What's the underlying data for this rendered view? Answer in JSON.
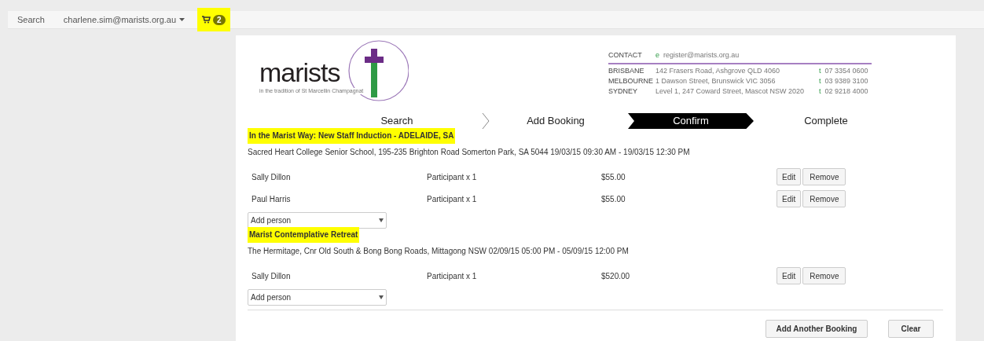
{
  "topbar": {
    "search": "Search",
    "user": "charlene.sim@marists.org.au",
    "cart": {
      "count": "2",
      "highlighted": true
    }
  },
  "logo": {
    "wordmark": "marists",
    "tagline": "in the tradition of St Marcellin Champagnat"
  },
  "contact": {
    "label": "CONTACT",
    "email_prefix": "e",
    "email": "register@marists.org.au",
    "offices": [
      {
        "city": "BRISBANE",
        "address": "142 Frasers Road, Ashgrove QLD 4060",
        "phone_prefix": "t",
        "phone": "07 3354 0600"
      },
      {
        "city": "MELBOURNE",
        "address": "1 Dawson Street, Brunswick VIC 3056",
        "phone_prefix": "t",
        "phone": "03 9389 3100"
      },
      {
        "city": "SYDNEY",
        "address": "Level 1, 247 Coward Street, Mascot NSW 2020",
        "phone_prefix": "t",
        "phone": "02 9218 4000"
      }
    ]
  },
  "steps": [
    {
      "label": "Search",
      "selected": false
    },
    {
      "label": "Add Booking",
      "selected": false
    },
    {
      "label": "Confirm",
      "selected": true
    },
    {
      "label": "Complete",
      "selected": false
    }
  ],
  "bookings": [
    {
      "title": "In the Marist Way: New Staff Induction - ADELAIDE, SA",
      "highlighted": true,
      "details": "Sacred Heart College Senior School, 195-235 Brighton Road Somerton Park, SA 5044 19/03/15 09:30 AM - 19/03/15 12:30 PM",
      "people": [
        {
          "name": "Sally Dillon",
          "type": "Participant x 1",
          "price": "$55.00",
          "edit": "Edit",
          "remove": "Remove"
        },
        {
          "name": "Paul Harris",
          "type": "Participant x 1",
          "price": "$55.00",
          "edit": "Edit",
          "remove": "Remove"
        }
      ],
      "add_person": "Add person"
    },
    {
      "title": "Marist Contemplative Retreat",
      "highlighted": true,
      "details": "The Hermitage, Cnr Old South & Bong Bong Roads, Mittagong NSW 02/09/15 05:00 PM - 05/09/15 12:00 PM",
      "people": [
        {
          "name": "Sally Dillon",
          "type": "Participant x 1",
          "price": "$520.00",
          "edit": "Edit",
          "remove": "Remove"
        }
      ],
      "add_person": "Add person"
    }
  ],
  "actions": {
    "add_another": "Add Another Booking",
    "clear": "Clear"
  }
}
